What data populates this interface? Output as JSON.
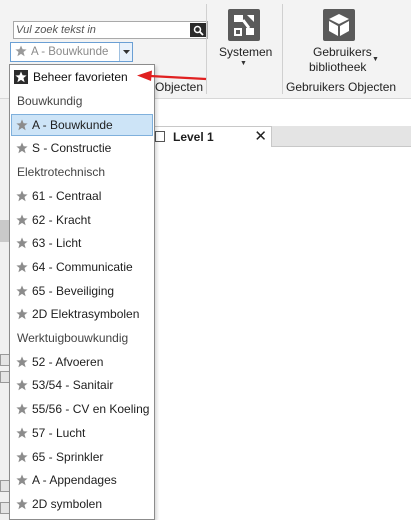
{
  "search": {
    "placeholder": "Vul zoek tekst in"
  },
  "combo": {
    "selected": "A - Bouwkunde"
  },
  "ribbon": {
    "objects_group_label": "Objecten",
    "systemen_label": "Systemen",
    "users_lib_label_line1": "Gebruikers",
    "users_lib_label_line2": "bibliotheek",
    "users_group_label": "Gebruikers Objecten"
  },
  "tab": {
    "label": "Level 1",
    "close": "✕"
  },
  "dropdown": {
    "manage_label": "Beheer favorieten",
    "groups": [
      {
        "header": "Bouwkundig",
        "items": [
          "A - Bouwkunde",
          "S - Constructie"
        ]
      },
      {
        "header": "Elektrotechnisch",
        "items": [
          "61 - Centraal",
          "62 - Kracht",
          "63 - Licht",
          "64 - Communicatie",
          "65 - Beveiliging",
          "2D Elektrasymbolen"
        ]
      },
      {
        "header": "Werktuigbouwkundig",
        "items": [
          "52 - Afvoeren",
          "53/54 - Sanitair",
          "55/56 - CV en Koeling",
          "57 - Lucht",
          "65 - Sprinkler",
          "A - Appendages",
          "2D symbolen"
        ]
      }
    ]
  },
  "colors": {
    "selection": "#cde4f7",
    "selection_border": "#7fb0dc",
    "arrow": "#e02020",
    "star": "#8c8c8c"
  }
}
